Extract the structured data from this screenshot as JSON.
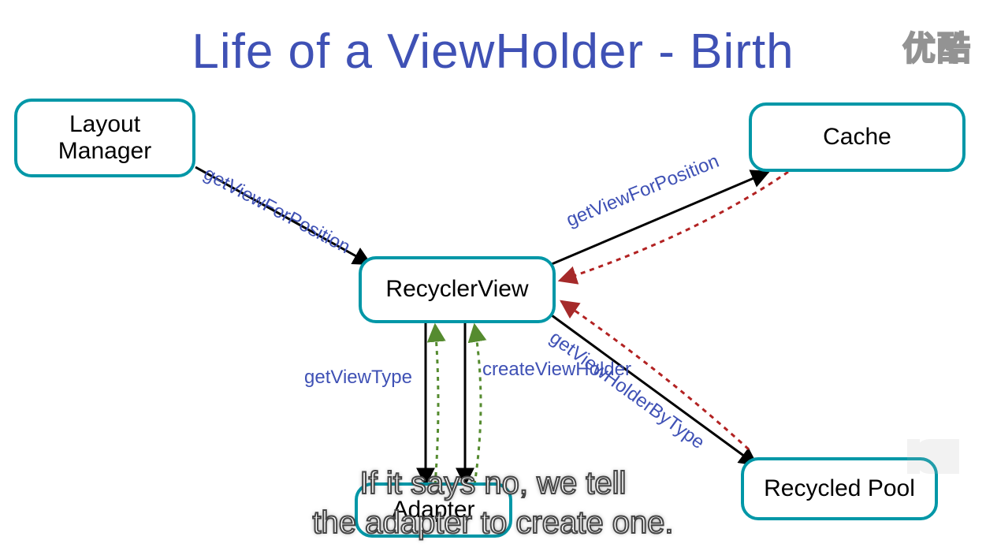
{
  "title": "Life of  a ViewHolder - Birth",
  "watermark": "优酷",
  "nodes": {
    "layout_manager": "Layout\nManager",
    "cache": "Cache",
    "recyclerview": "RecyclerView",
    "adapter": "Adapter",
    "recycled_pool": "Recycled Pool"
  },
  "edges": {
    "lm_to_rv": "getViewForPosition",
    "rv_to_cache": "getViewForPosition",
    "rv_to_adapter_type": "getViewType",
    "rv_to_adapter_create": "createViewHolder",
    "rv_to_pool": "getViewHolderByType"
  },
  "subtitle": "If it says no, we tell\nthe adapter to create one."
}
